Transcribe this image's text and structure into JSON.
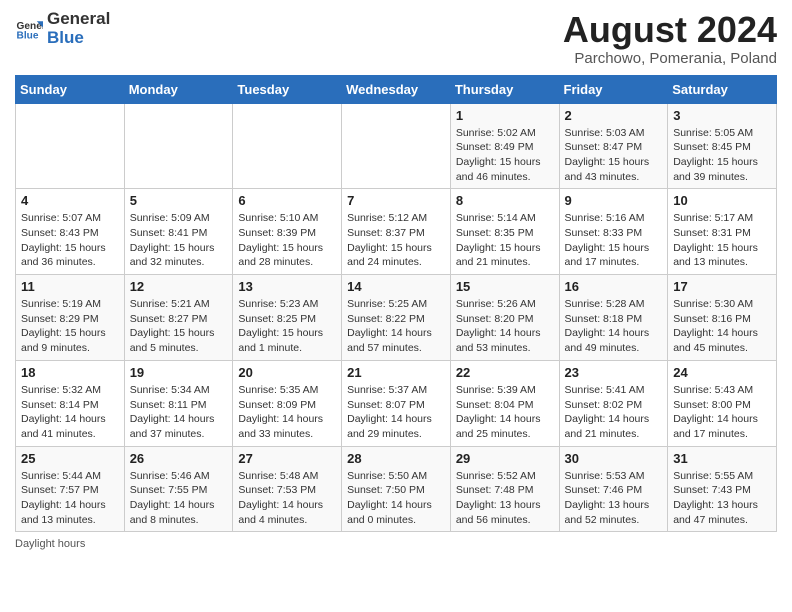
{
  "header": {
    "logo_general": "General",
    "logo_blue": "Blue",
    "title": "August 2024",
    "subtitle": "Parchowo, Pomerania, Poland"
  },
  "weekdays": [
    "Sunday",
    "Monday",
    "Tuesday",
    "Wednesday",
    "Thursday",
    "Friday",
    "Saturday"
  ],
  "weeks": [
    [
      {
        "day": "",
        "sunrise": "",
        "sunset": "",
        "daylight": ""
      },
      {
        "day": "",
        "sunrise": "",
        "sunset": "",
        "daylight": ""
      },
      {
        "day": "",
        "sunrise": "",
        "sunset": "",
        "daylight": ""
      },
      {
        "day": "",
        "sunrise": "",
        "sunset": "",
        "daylight": ""
      },
      {
        "day": "1",
        "sunrise": "Sunrise: 5:02 AM",
        "sunset": "Sunset: 8:49 PM",
        "daylight": "Daylight: 15 hours and 46 minutes."
      },
      {
        "day": "2",
        "sunrise": "Sunrise: 5:03 AM",
        "sunset": "Sunset: 8:47 PM",
        "daylight": "Daylight: 15 hours and 43 minutes."
      },
      {
        "day": "3",
        "sunrise": "Sunrise: 5:05 AM",
        "sunset": "Sunset: 8:45 PM",
        "daylight": "Daylight: 15 hours and 39 minutes."
      }
    ],
    [
      {
        "day": "4",
        "sunrise": "Sunrise: 5:07 AM",
        "sunset": "Sunset: 8:43 PM",
        "daylight": "Daylight: 15 hours and 36 minutes."
      },
      {
        "day": "5",
        "sunrise": "Sunrise: 5:09 AM",
        "sunset": "Sunset: 8:41 PM",
        "daylight": "Daylight: 15 hours and 32 minutes."
      },
      {
        "day": "6",
        "sunrise": "Sunrise: 5:10 AM",
        "sunset": "Sunset: 8:39 PM",
        "daylight": "Daylight: 15 hours and 28 minutes."
      },
      {
        "day": "7",
        "sunrise": "Sunrise: 5:12 AM",
        "sunset": "Sunset: 8:37 PM",
        "daylight": "Daylight: 15 hours and 24 minutes."
      },
      {
        "day": "8",
        "sunrise": "Sunrise: 5:14 AM",
        "sunset": "Sunset: 8:35 PM",
        "daylight": "Daylight: 15 hours and 21 minutes."
      },
      {
        "day": "9",
        "sunrise": "Sunrise: 5:16 AM",
        "sunset": "Sunset: 8:33 PM",
        "daylight": "Daylight: 15 hours and 17 minutes."
      },
      {
        "day": "10",
        "sunrise": "Sunrise: 5:17 AM",
        "sunset": "Sunset: 8:31 PM",
        "daylight": "Daylight: 15 hours and 13 minutes."
      }
    ],
    [
      {
        "day": "11",
        "sunrise": "Sunrise: 5:19 AM",
        "sunset": "Sunset: 8:29 PM",
        "daylight": "Daylight: 15 hours and 9 minutes."
      },
      {
        "day": "12",
        "sunrise": "Sunrise: 5:21 AM",
        "sunset": "Sunset: 8:27 PM",
        "daylight": "Daylight: 15 hours and 5 minutes."
      },
      {
        "day": "13",
        "sunrise": "Sunrise: 5:23 AM",
        "sunset": "Sunset: 8:25 PM",
        "daylight": "Daylight: 15 hours and 1 minute."
      },
      {
        "day": "14",
        "sunrise": "Sunrise: 5:25 AM",
        "sunset": "Sunset: 8:22 PM",
        "daylight": "Daylight: 14 hours and 57 minutes."
      },
      {
        "day": "15",
        "sunrise": "Sunrise: 5:26 AM",
        "sunset": "Sunset: 8:20 PM",
        "daylight": "Daylight: 14 hours and 53 minutes."
      },
      {
        "day": "16",
        "sunrise": "Sunrise: 5:28 AM",
        "sunset": "Sunset: 8:18 PM",
        "daylight": "Daylight: 14 hours and 49 minutes."
      },
      {
        "day": "17",
        "sunrise": "Sunrise: 5:30 AM",
        "sunset": "Sunset: 8:16 PM",
        "daylight": "Daylight: 14 hours and 45 minutes."
      }
    ],
    [
      {
        "day": "18",
        "sunrise": "Sunrise: 5:32 AM",
        "sunset": "Sunset: 8:14 PM",
        "daylight": "Daylight: 14 hours and 41 minutes."
      },
      {
        "day": "19",
        "sunrise": "Sunrise: 5:34 AM",
        "sunset": "Sunset: 8:11 PM",
        "daylight": "Daylight: 14 hours and 37 minutes."
      },
      {
        "day": "20",
        "sunrise": "Sunrise: 5:35 AM",
        "sunset": "Sunset: 8:09 PM",
        "daylight": "Daylight: 14 hours and 33 minutes."
      },
      {
        "day": "21",
        "sunrise": "Sunrise: 5:37 AM",
        "sunset": "Sunset: 8:07 PM",
        "daylight": "Daylight: 14 hours and 29 minutes."
      },
      {
        "day": "22",
        "sunrise": "Sunrise: 5:39 AM",
        "sunset": "Sunset: 8:04 PM",
        "daylight": "Daylight: 14 hours and 25 minutes."
      },
      {
        "day": "23",
        "sunrise": "Sunrise: 5:41 AM",
        "sunset": "Sunset: 8:02 PM",
        "daylight": "Daylight: 14 hours and 21 minutes."
      },
      {
        "day": "24",
        "sunrise": "Sunrise: 5:43 AM",
        "sunset": "Sunset: 8:00 PM",
        "daylight": "Daylight: 14 hours and 17 minutes."
      }
    ],
    [
      {
        "day": "25",
        "sunrise": "Sunrise: 5:44 AM",
        "sunset": "Sunset: 7:57 PM",
        "daylight": "Daylight: 14 hours and 13 minutes."
      },
      {
        "day": "26",
        "sunrise": "Sunrise: 5:46 AM",
        "sunset": "Sunset: 7:55 PM",
        "daylight": "Daylight: 14 hours and 8 minutes."
      },
      {
        "day": "27",
        "sunrise": "Sunrise: 5:48 AM",
        "sunset": "Sunset: 7:53 PM",
        "daylight": "Daylight: 14 hours and 4 minutes."
      },
      {
        "day": "28",
        "sunrise": "Sunrise: 5:50 AM",
        "sunset": "Sunset: 7:50 PM",
        "daylight": "Daylight: 14 hours and 0 minutes."
      },
      {
        "day": "29",
        "sunrise": "Sunrise: 5:52 AM",
        "sunset": "Sunset: 7:48 PM",
        "daylight": "Daylight: 13 hours and 56 minutes."
      },
      {
        "day": "30",
        "sunrise": "Sunrise: 5:53 AM",
        "sunset": "Sunset: 7:46 PM",
        "daylight": "Daylight: 13 hours and 52 minutes."
      },
      {
        "day": "31",
        "sunrise": "Sunrise: 5:55 AM",
        "sunset": "Sunset: 7:43 PM",
        "daylight": "Daylight: 13 hours and 47 minutes."
      }
    ]
  ],
  "footer": {
    "note": "Daylight hours"
  }
}
